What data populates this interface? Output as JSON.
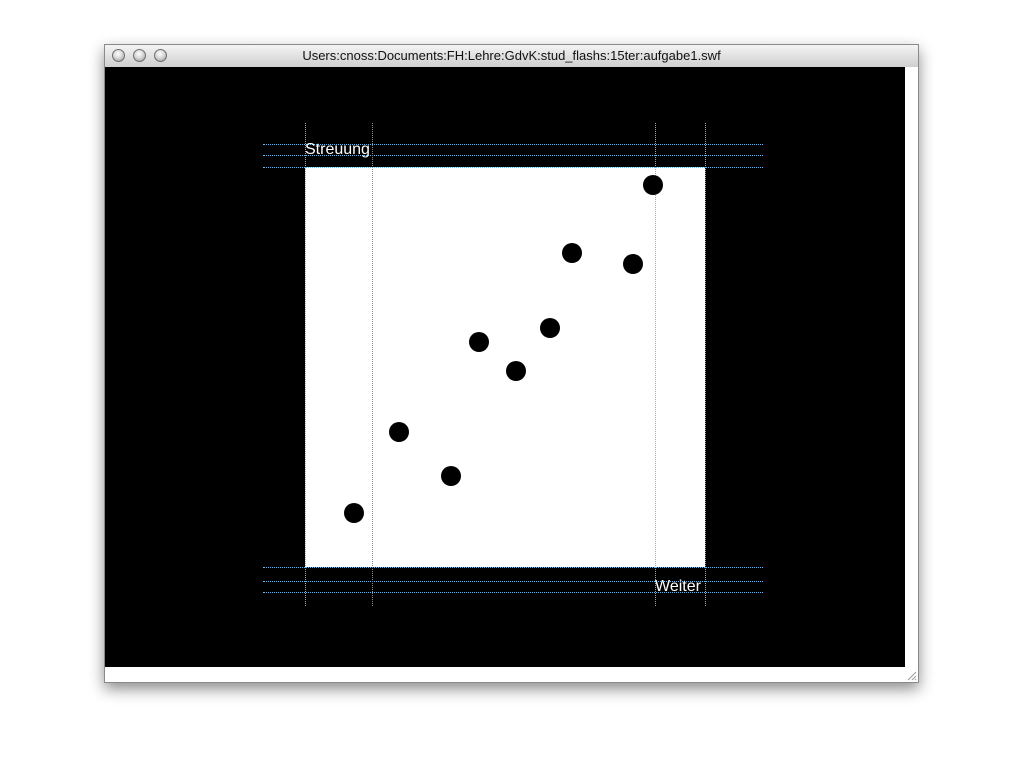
{
  "window": {
    "title": "Users:cnoss:Documents:FH:Lehre:GdvK:stud_flashs:15ter:aufgabe1.swf"
  },
  "stage": {
    "top_label": "Streuung",
    "bottom_label": "Weiter"
  },
  "icons": {
    "close": "window-close-icon",
    "minimize": "window-minimize-icon",
    "zoom": "window-zoom-icon",
    "resize": "resize-grip-icon"
  },
  "colors": {
    "stage_background": "#000000",
    "canvas": "#ffffff",
    "guide_blue": "#6fb6e6",
    "dot": "#000000"
  }
}
